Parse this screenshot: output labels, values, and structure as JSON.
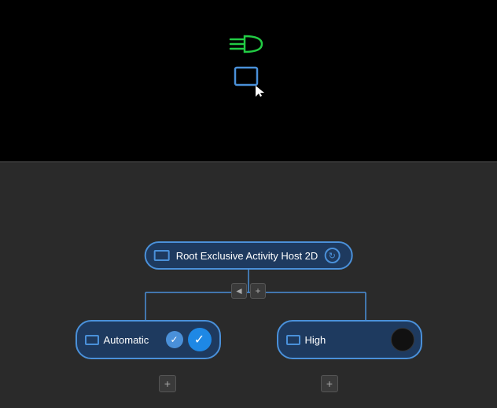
{
  "preview": {
    "background": "#000000",
    "headlight_icon_color": "#22cc44",
    "monitor_icon_color": "#4a90d9"
  },
  "tree": {
    "root_node": {
      "label": "Root Exclusive Activity Host 2D",
      "icon": "monitor-icon",
      "refresh_icon": "↻"
    },
    "controls": {
      "collapse_label": "◄",
      "expand_label": "+"
    },
    "child_nodes": [
      {
        "id": "automatic",
        "label": "Automatic",
        "icon": "monitor-icon",
        "has_check": true,
        "has_confirm": true
      },
      {
        "id": "high",
        "label": "High",
        "icon": "monitor-icon",
        "has_check": false,
        "has_confirm": false
      }
    ],
    "add_button_label": "+"
  }
}
